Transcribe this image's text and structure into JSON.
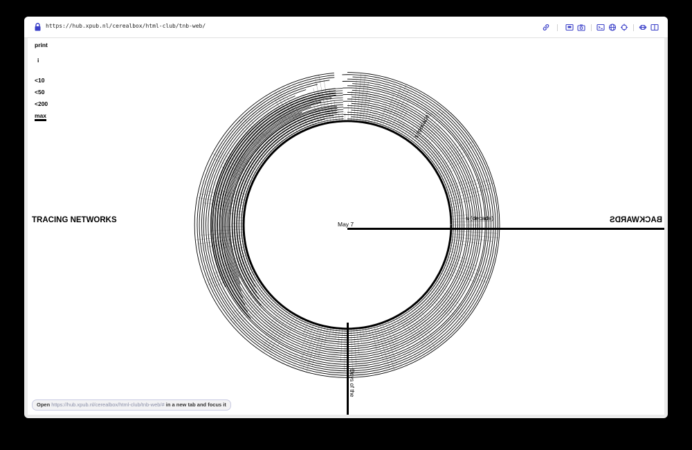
{
  "browser": {
    "url": "https://hub.xpub.nl/cerealbox/html-club/tnb-web/",
    "toolbar_icons": [
      "link-icon",
      "screenshot-icon",
      "camera-icon",
      "terminal-icon",
      "globe-icon",
      "crosshair-icon",
      "resize-icon",
      "sidebar-icon"
    ]
  },
  "menu": {
    "print": "print",
    "info": "i",
    "filters": [
      "<10",
      "<50",
      "<200",
      "max"
    ],
    "active_filter": "max"
  },
  "page": {
    "title_left": "TRACING NETWORKS",
    "title_right": "BACKWARDS",
    "center_label": "May 7",
    "label_upper": "s (decade)",
    "label_right": "s (decade)",
    "label_vertical": "Days of the"
  },
  "status": {
    "prefix": "Open",
    "url": "https://hub.xpub.nl/cerealbox/html-club/tnb-web/#",
    "suffix": "in a new tab and focus it"
  },
  "colors": {
    "accent": "#3a3fc8",
    "ink": "#000000"
  }
}
